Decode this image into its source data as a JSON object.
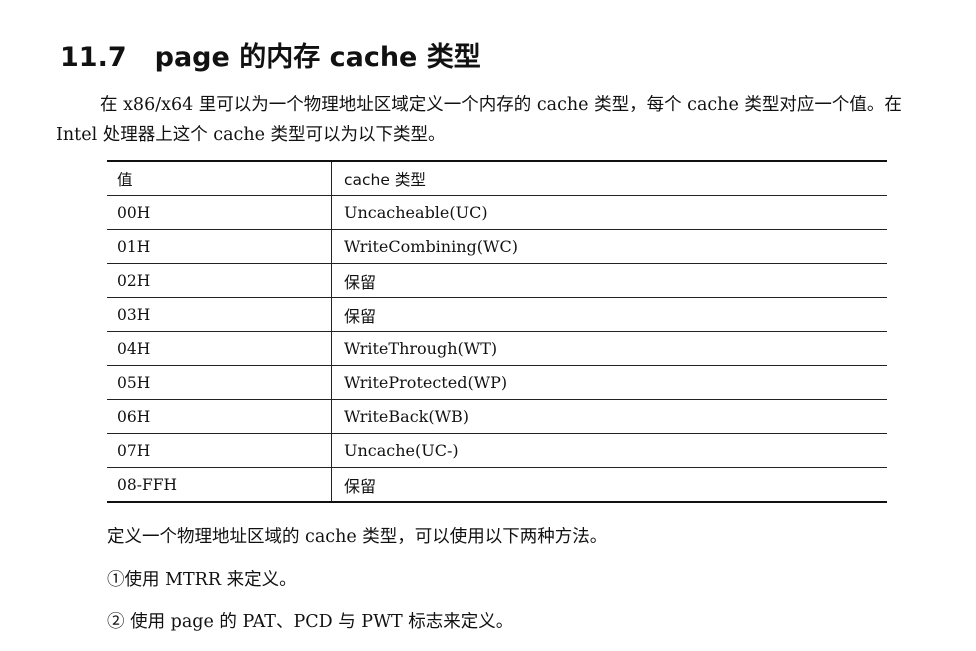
{
  "section": {
    "number": "11.7",
    "title": "page 的内存 cache 类型"
  },
  "intro": "在 x86/x64 里可以为一个物理地址区域定义一个内存的 cache 类型，每个 cache 类型对应一个值。在 Intel 处理器上这个 cache 类型可以为以下类型。",
  "table": {
    "headers": [
      "值",
      "cache 类型"
    ],
    "rows": [
      [
        "00H",
        "Uncacheable(UC)"
      ],
      [
        "01H",
        "WriteCombining(WC)"
      ],
      [
        "02H",
        "保留"
      ],
      [
        "03H",
        "保留"
      ],
      [
        "04H",
        "WriteThrough(WT)"
      ],
      [
        "05H",
        "WriteProtected(WP)"
      ],
      [
        "06H",
        "WriteBack(WB)"
      ],
      [
        "07H",
        "Uncache(UC-)"
      ],
      [
        "08-FFH",
        "保留"
      ]
    ]
  },
  "after_text": "定义一个物理地址区域的 cache 类型，可以使用以下两种方法。",
  "methods": [
    "①使用 MTRR 来定义。",
    "② 使用 page 的 PAT、PCD 与 PWT 标志来定义。"
  ]
}
